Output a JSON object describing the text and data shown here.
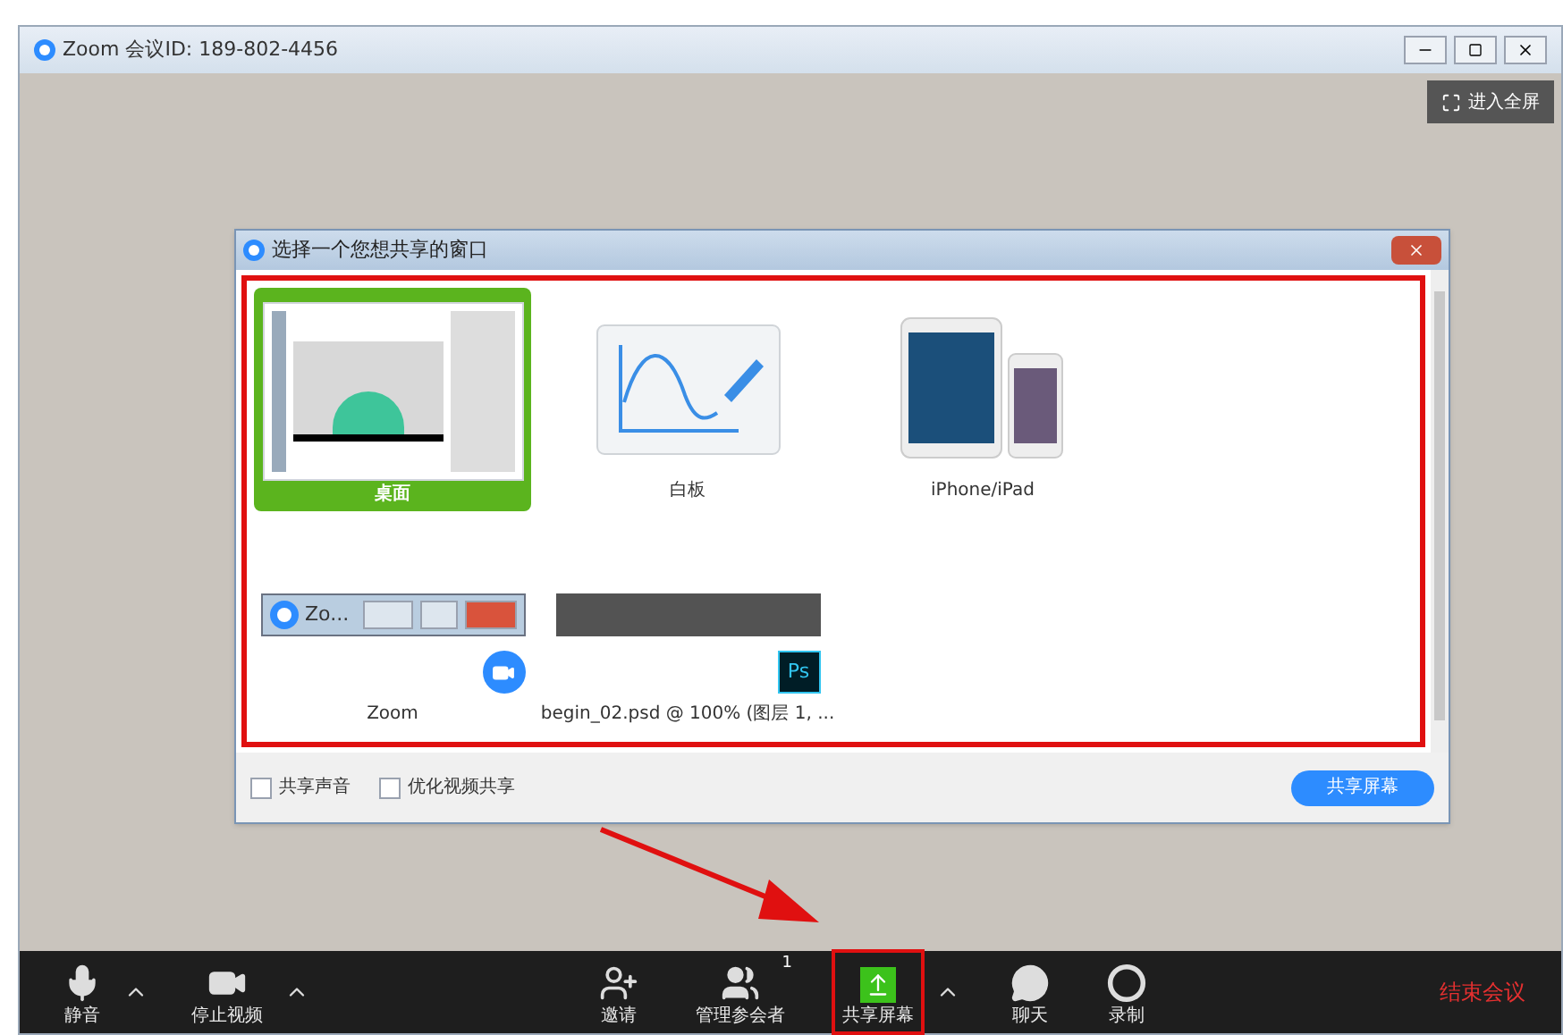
{
  "window": {
    "title": "Zoom 会议ID: 189-802-4456",
    "fullscreen_button": "进入全屏"
  },
  "dialog": {
    "title": "选择一个您想共享的窗口",
    "highlighted": true,
    "items": [
      {
        "kind": "desktop",
        "label": "桌面",
        "selected": true
      },
      {
        "kind": "whiteboard",
        "label": "白板",
        "selected": false
      },
      {
        "kind": "device",
        "label": "iPhone/iPad",
        "selected": false
      },
      {
        "kind": "zoom-window",
        "label": "Zoom",
        "thumb_title": "Zo...",
        "selected": false
      },
      {
        "kind": "ps-window",
        "label": "begin_02.psd @ 100% (图层 1, ...",
        "app_badge": "Ps",
        "selected": false
      }
    ],
    "options": [
      {
        "label": "共享声音",
        "checked": false
      },
      {
        "label": "优化视频共享",
        "checked": false
      }
    ],
    "share_button": "共享屏幕"
  },
  "toolbar": {
    "items": [
      {
        "kind": "mic",
        "label": "静音",
        "caret": true,
        "highlighted": false
      },
      {
        "kind": "video",
        "label": "停止视频",
        "caret": true,
        "highlighted": false
      },
      {
        "kind": "invite",
        "label": "邀请",
        "caret": false,
        "highlighted": false
      },
      {
        "kind": "participants",
        "label": "管理参会者",
        "badge": "1",
        "caret": false,
        "highlighted": false
      },
      {
        "kind": "share",
        "label": "共享屏幕",
        "caret": true,
        "highlighted": true
      },
      {
        "kind": "chat",
        "label": "聊天",
        "caret": false,
        "highlighted": false
      },
      {
        "kind": "record",
        "label": "录制",
        "caret": false,
        "highlighted": false
      }
    ],
    "end_button": "结束会议"
  }
}
